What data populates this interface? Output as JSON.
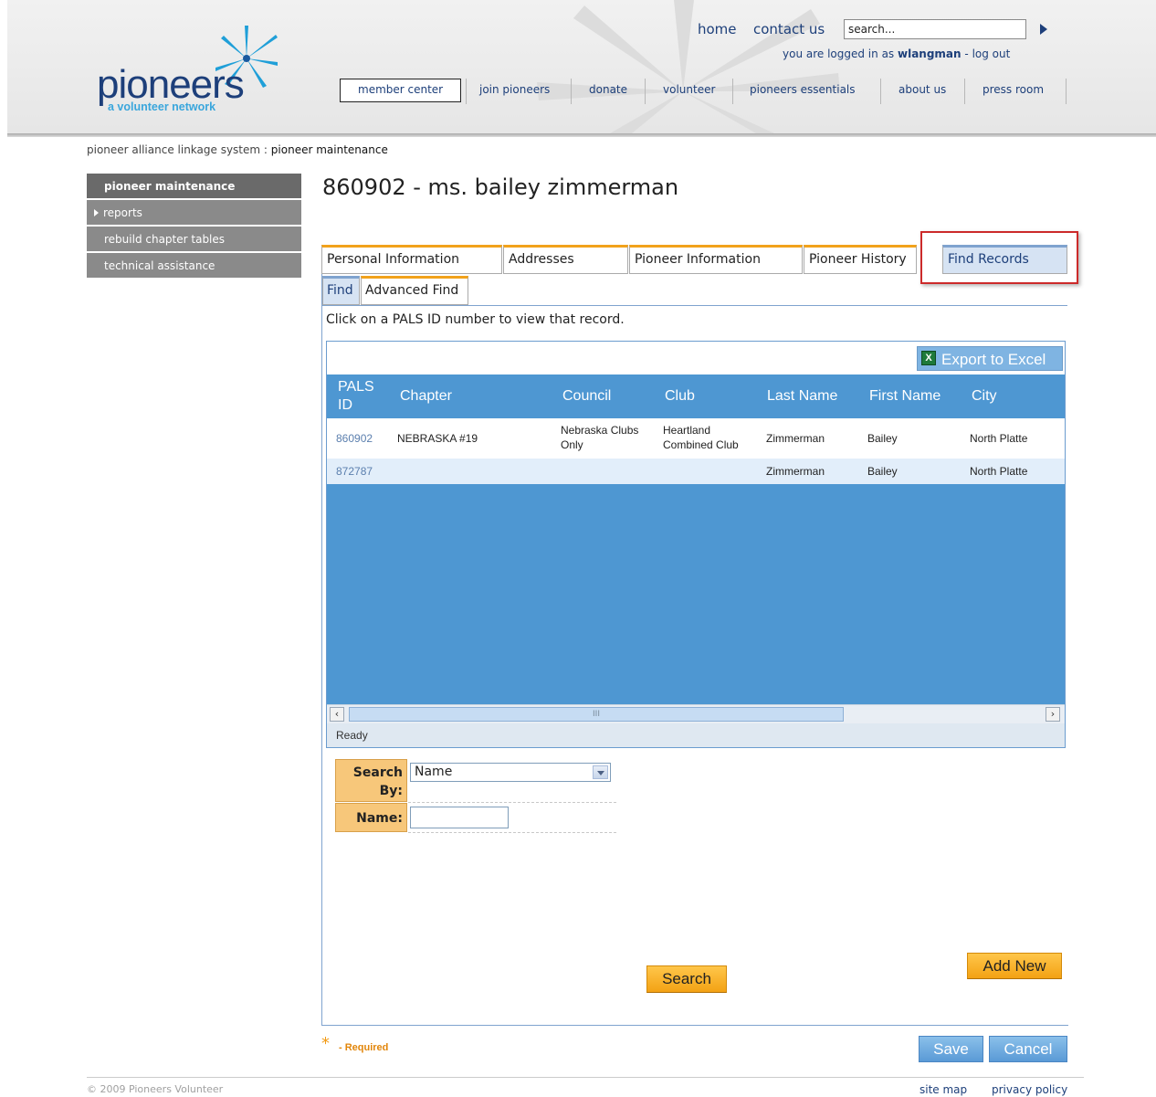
{
  "header": {
    "logo": "pioneers",
    "logo_tagline": "a volunteer network",
    "top_links": {
      "home": "home",
      "contact_us": "contact us"
    },
    "search_value": "search...",
    "login_prefix": "you are logged in as",
    "username": "wlangman",
    "login_separator": "-",
    "logout": "log out",
    "nav": [
      {
        "label": "member center"
      },
      {
        "label": "join pioneers"
      },
      {
        "label": "donate"
      },
      {
        "label": "volunteer"
      },
      {
        "label": "pioneers essentials"
      },
      {
        "label": "about us"
      },
      {
        "label": "press room"
      }
    ]
  },
  "breadcrumb": {
    "root": "pioneer alliance linkage system",
    "separator": ":",
    "current": "pioneer maintenance"
  },
  "sidebar": {
    "items": [
      {
        "label": "pioneer maintenance"
      },
      {
        "label": "reports"
      },
      {
        "label": "rebuild chapter tables"
      },
      {
        "label": "technical assistance"
      }
    ]
  },
  "page": {
    "title": "860902 - ms. bailey zimmerman"
  },
  "tabs": [
    {
      "label": "Personal Information"
    },
    {
      "label": "Addresses"
    },
    {
      "label": "Pioneer Information"
    },
    {
      "label": "Pioneer History"
    },
    {
      "label": "Find Records"
    }
  ],
  "subtabs": [
    {
      "label": "Find"
    },
    {
      "label": "Advanced Find"
    }
  ],
  "hint": "Click on a PALS ID number to view that record.",
  "grid": {
    "export_label": "Export to Excel",
    "export_icon": "excel-icon",
    "columns": [
      "PALS ID",
      "Chapter",
      "Council",
      "Club",
      "Last Name",
      "First Name",
      "City"
    ],
    "rows": [
      {
        "pals_id": "860902",
        "chapter": "NEBRASKA #19",
        "council": "Nebraska Clubs Only",
        "club": "Heartland Combined Club",
        "last_name": "Zimmerman",
        "first_name": "Bailey",
        "city": "North Platte"
      },
      {
        "pals_id": "872787",
        "chapter": "",
        "council": "",
        "club": "",
        "last_name": "Zimmerman",
        "first_name": "Bailey",
        "city": "North Platte"
      }
    ],
    "scroll_grip": "III",
    "status": "Ready"
  },
  "search_form": {
    "search_by_label": "Search By:",
    "search_by_value": "Name",
    "name_label": "Name:",
    "name_value": ""
  },
  "buttons": {
    "search": "Search",
    "add_new": "Add New",
    "save": "Save",
    "cancel": "Cancel"
  },
  "required_note": {
    "star": "*",
    "text": "- Required"
  },
  "footer": {
    "copyright": "© 2009 Pioneers Volunteer",
    "links": {
      "site_map": "site map",
      "privacy_policy": "privacy policy"
    }
  }
}
